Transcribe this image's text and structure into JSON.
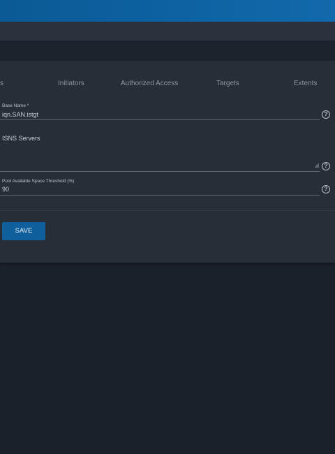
{
  "tabs": [
    {
      "label": "s"
    },
    {
      "label": "Initiators"
    },
    {
      "label": "Authorized Access"
    },
    {
      "label": "Targets"
    },
    {
      "label": "Extents"
    }
  ],
  "form": {
    "base_name": {
      "label": "Base Name *",
      "value": "iqn.SAN.istgt"
    },
    "isns_servers": {
      "label": "ISNS Servers",
      "value": ""
    },
    "pool_threshold": {
      "label": "Pool Available Space Threshold (%)",
      "value": "90"
    },
    "help_glyph": "?",
    "save_label": "SAVE"
  },
  "colors": {
    "topbar": "#0e63a3",
    "card": "#262e38",
    "save_button": "#0e5f9c",
    "background": "#1b212b"
  }
}
